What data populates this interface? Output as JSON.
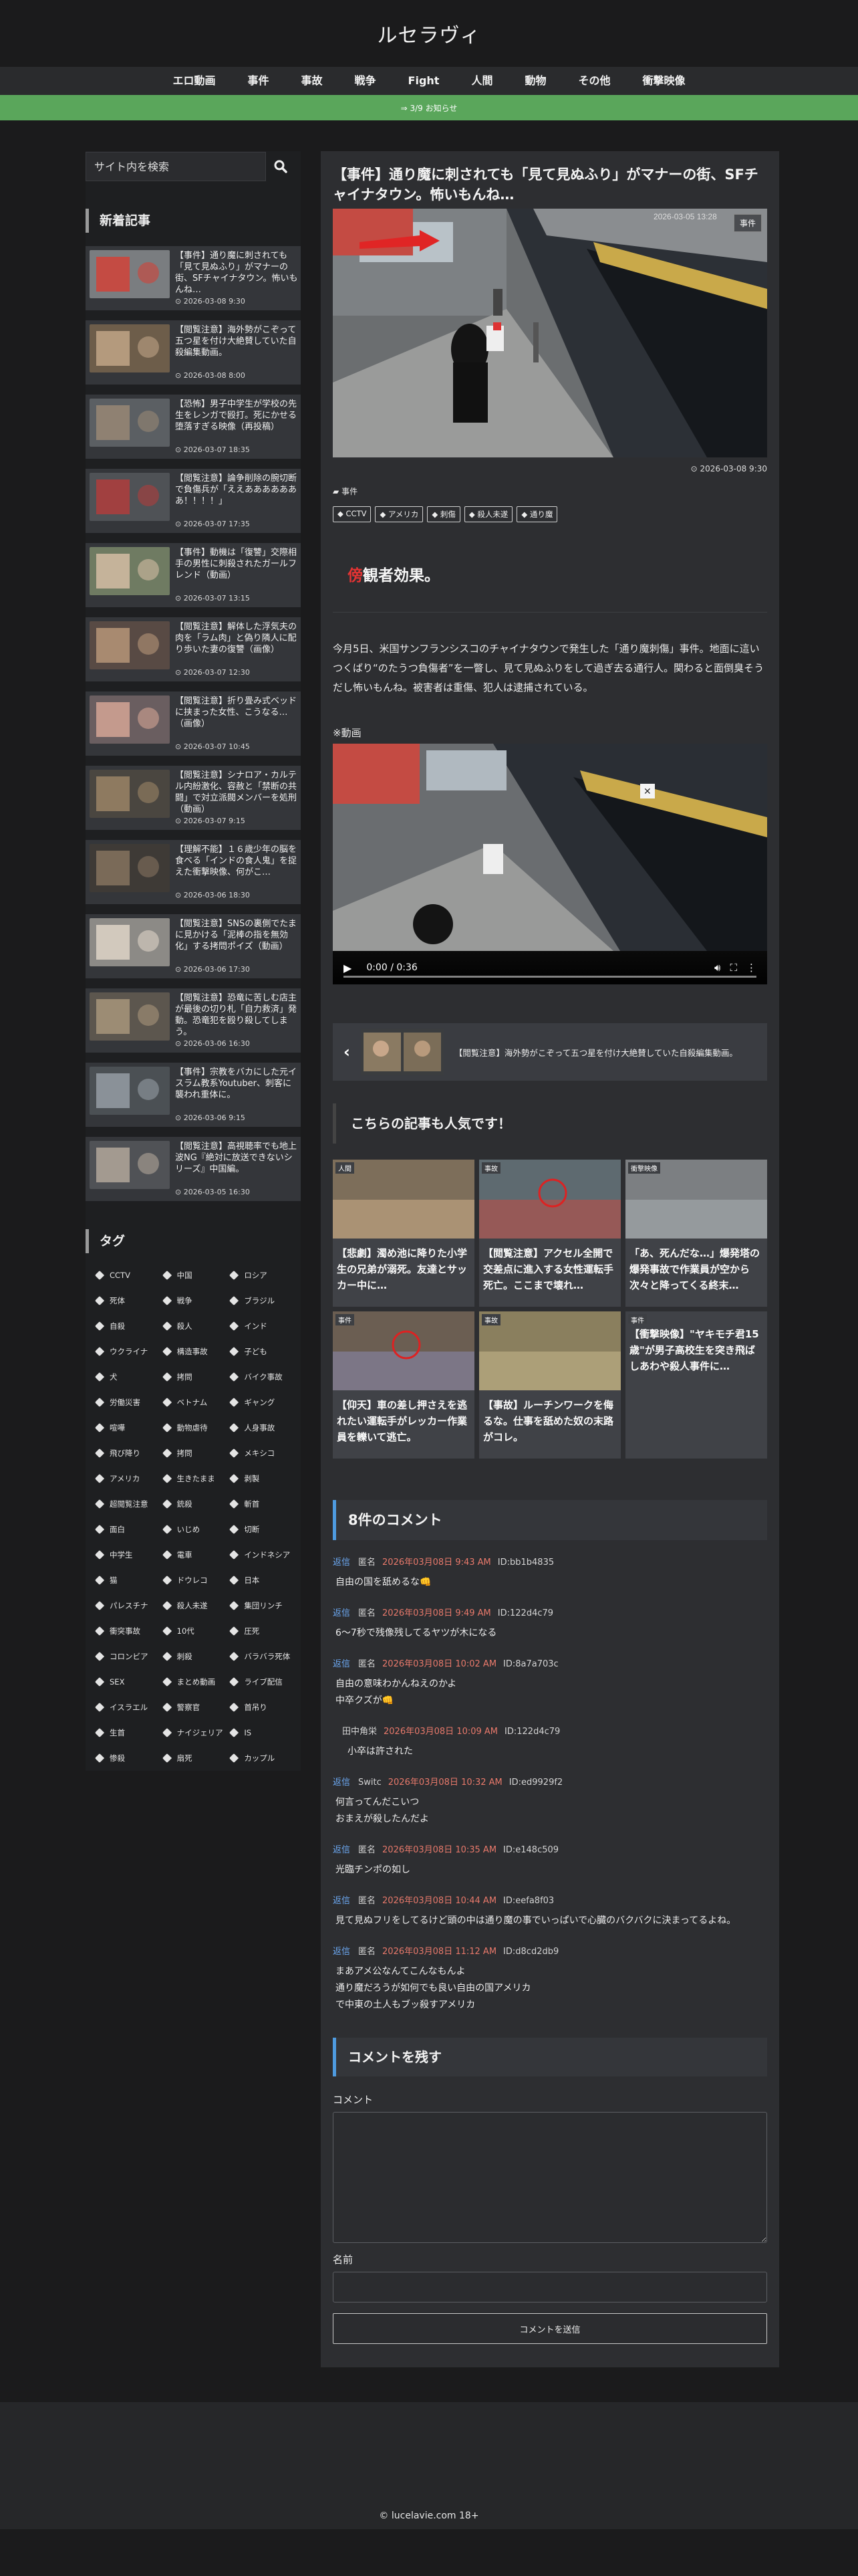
{
  "site": {
    "title": "ルセラヴィ"
  },
  "nav": [
    "エロ動画",
    "事件",
    "事故",
    "戦争",
    "Fight",
    "人間",
    "動物",
    "その他",
    "衝撃映像"
  ],
  "notice": "⇒ 3/9 お知らせ",
  "search": {
    "placeholder": "サイト内を検索"
  },
  "sidebar": {
    "recent_title": "新着記事",
    "recent": [
      {
        "title": "【事件】通り魔に刺されても「見て見ぬふり」がマナーの街、SFチャイナタウン。怖いもんね…",
        "date": "2026-03-08 9:30"
      },
      {
        "title": "【閲覧注意】海外勢がこぞって五つ星を付け大絶賛していた自殺編集動画。",
        "date": "2026-03-08 8:00"
      },
      {
        "title": "【恐怖】男子中学生が学校の先生をレンガで殴打。死にかせる堕落すぎる映像（再投稿）",
        "date": "2026-03-07 18:35"
      },
      {
        "title": "【閲覧注意】論争削除の腕切断で負傷兵が「ええあああああああ！！！！」",
        "date": "2026-03-07 17:35"
      },
      {
        "title": "【事件】動機は「復讐」交際相手の男性に刺殺されたガールフレンド（動画）",
        "date": "2026-03-07 13:15"
      },
      {
        "title": "【閲覧注意】解体した浮気夫の肉を「ラム肉」と偽り隣人に配り歩いた妻の復讐（画像）",
        "date": "2026-03-07 12:30"
      },
      {
        "title": "【閲覧注意】折り畳み式ベッドに挟まった女性、こうなる…（画像）",
        "date": "2026-03-07 10:45"
      },
      {
        "title": "【閲覧注意】シナロア・カルテル内紛激化、容赦と「禁断の共闘」で対立派閥メンバーを処刑（動画）",
        "date": "2026-03-07 9:15"
      },
      {
        "title": "【理解不能】１６歳少年の脳を食べる「インドの食人鬼」を捉えた衝撃映像、何がこ…",
        "date": "2026-03-06 18:30"
      },
      {
        "title": "【閲覧注意】SNSの裏側でたまに見かける「泥棒の指を無効化」する拷問ポイズ（動画）",
        "date": "2026-03-06 17:30"
      },
      {
        "title": "【閲覧注意】恐竜に苦しむ店主が最後の切り札「自力救済」発動。恐竜犯を殴り殺してしまう。",
        "date": "2026-03-06 16:30"
      },
      {
        "title": "【事件】宗教をバカにした元イスラム教系Youtuber、刺客に襲われ重体に。",
        "date": "2026-03-06 9:15"
      },
      {
        "title": "【閲覧注意】高視聴率でも地上波NG『絶対に放送できないシリーズ』中国編。",
        "date": "2026-03-05 16:30"
      }
    ],
    "tags_title": "タグ",
    "tags": [
      "CCTV",
      "中国",
      "ロシア",
      "死体",
      "戦争",
      "ブラジル",
      "自殺",
      "殺人",
      "インド",
      "ウクライナ",
      "構造事故",
      "子ども",
      "犬",
      "拷問",
      "バイク事故",
      "労働災害",
      "ベトナム",
      "ギャング",
      "喧嘩",
      "動物虐待",
      "人身事故",
      "飛び降り",
      "拷問",
      "メキシコ",
      "アメリカ",
      "生きたまま",
      "剥製",
      "超閲覧注意",
      "銃殺",
      "斬首",
      "面白",
      "いじめ",
      "切断",
      "中学生",
      "電車",
      "インドネシア",
      "猫",
      "ドウレコ",
      "日本",
      "パレスチナ",
      "殺人未遂",
      "集団リンチ",
      "衝突事故",
      "10代",
      "圧死",
      "コロンビア",
      "刺殺",
      "バラバラ死体",
      "SEX",
      "まとめ動画",
      "ライブ配信",
      "イスラエル",
      "警察官",
      "首吊り",
      "生首",
      "ナイジェリア",
      "IS",
      "惨殺",
      "扇死",
      "カップル"
    ]
  },
  "article": {
    "title": "【事件】通り魔に刺されても「見て見ぬふり」がマナーの街、SFチャイナタウン。怖いもんね…",
    "category_badge": "事件",
    "date": "2026-03-08 9:30",
    "category": "事件",
    "tags": [
      "CCTV",
      "アメリカ",
      "刺傷",
      "殺人未遂",
      "通り魔"
    ],
    "highlight_red": "傍",
    "highlight_rest": "観者効果。",
    "body": "今月5日、米国サンフランシスコのチャイナタウンで発生した「通り魔刺傷」事件。地面に這いつくばり“のたうつ負傷者”を一瞥し、見て見ぬふりをして過ぎ去る通行人。関わると面倒臭そうだし怖いもんね。被害者は重傷、犯人は逮捕されている。",
    "video_label": "※動画",
    "video_time": "0:00 / 0:36",
    "prev_title": "【閲覧注意】海外勢がこぞって五つ星を付け大絶賛していた自殺編集動画。"
  },
  "popular": {
    "heading": "こちらの記事も人気です！",
    "items": [
      {
        "badge": "人間",
        "title": "【悲劇】濁め池に降りた小学生の兄弟が溺死。友達とサッカー中に…"
      },
      {
        "badge": "事故",
        "title": "【閲覧注意】アクセル全開で交差点に進入する女性運転手死亡。ここまで壊れ…"
      },
      {
        "badge": "衝撃映像",
        "title": "「あ、死んだな…」爆発塔の爆発事故で作業員が空から次々と降ってくる終末…"
      },
      {
        "badge": "事件",
        "title": "【仰天】車の差し押さえを逃れたい運転手がレッカー作業員を轢いて逃亡。"
      },
      {
        "badge": "事故",
        "title": "【事故】ルーチンワークを侮るな。仕事を舐めた奴の末路がコレ。"
      },
      {
        "badge": "事件",
        "title": "【衝撃映像】\"ヤキモチ君15歳\"が男子高校生を突き飛ばしあわや殺人事件に…"
      }
    ]
  },
  "comments": {
    "heading": "8件のコメント",
    "reply_label": "返信",
    "items": [
      {
        "name": "匿名",
        "date": "2026年03月08日 9:43 AM",
        "id": "ID:bb1b4835",
        "text": "自由の国を舐めるな👊"
      },
      {
        "name": "匿名",
        "date": "2026年03月08日 9:49 AM",
        "id": "ID:122d4c79",
        "text": "6〜7秒で残像残してるヤツが木になる"
      },
      {
        "name": "匿名",
        "date": "2026年03月08日 10:02 AM",
        "id": "ID:8a7a703c",
        "text": "自由の意味わかんねえのかよ\n中卒クズが👊"
      },
      {
        "name": "田中角栄",
        "date": "2026年03月08日 10:09 AM",
        "id": "ID:122d4c79",
        "text": "小卒は許された"
      },
      {
        "name": "Switc",
        "date": "2026年03月08日 10:32 AM",
        "id": "ID:ed9929f2",
        "text": "何言ってんだこいつ\nおまえが殺したんだよ"
      },
      {
        "name": "匿名",
        "date": "2026年03月08日 10:35 AM",
        "id": "ID:e148c509",
        "text": "光臨チンポの如し"
      },
      {
        "name": "匿名",
        "date": "2026年03月08日 10:44 AM",
        "id": "ID:eefa8f03",
        "text": "見て見ぬフリをしてるけど頭の中は通り魔の事でいっぱいで心臓のバクバクに決まってるよね。"
      },
      {
        "name": "匿名",
        "date": "2026年03月08日 11:12 AM",
        "id": "ID:d8cd2db9",
        "text": "まあアメ公なんてこんなもんよ\n通り魔だろうが如何でも良い自由の国アメリカ\nで中東の土人もブッ殺すアメリカ"
      }
    ]
  },
  "form": {
    "heading": "コメントを残す",
    "comment_label": "コメント",
    "name_label": "名前",
    "submit_label": "コメントを送信"
  },
  "footer": {
    "copyright": "© lucelavie.com 18+"
  }
}
